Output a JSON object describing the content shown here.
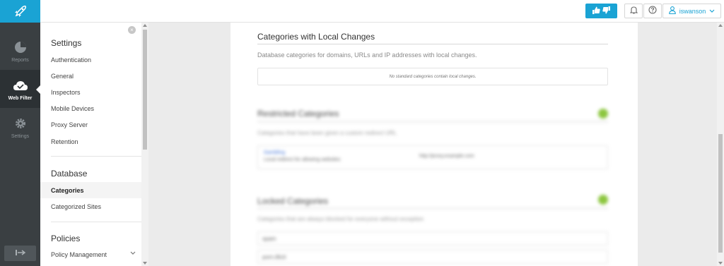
{
  "rail": {
    "items": [
      {
        "label": "Reports",
        "icon": "pie-chart-icon"
      },
      {
        "label": "Web Filter",
        "icon": "cloud-check-icon"
      },
      {
        "label": "Settings",
        "icon": "gear-icon"
      }
    ],
    "active": "Web Filter"
  },
  "topbar": {
    "username": "iswanson"
  },
  "sidenav": {
    "settings_heading": "Settings",
    "settings_items": [
      "Authentication",
      "General",
      "Inspectors",
      "Mobile Devices",
      "Proxy Server",
      "Retention"
    ],
    "database_heading": "Database",
    "database_items": [
      "Categories",
      "Categorized Sites"
    ],
    "policies_heading": "Policies",
    "policies_items": [
      "Policy Management"
    ],
    "active": "Categories"
  },
  "main": {
    "local_changes": {
      "title": "Categories with Local Changes",
      "description": "Database categories for domains, URLs and IP addresses with local changes.",
      "empty_message": "No standard categories contain local changes."
    },
    "restricted": {
      "title": "Restricted Categories",
      "description": "Categories that have been given a custom redirect URL",
      "item_name": "Gambling",
      "item_desc": "Local redirect for allowing websites",
      "item_url": "http://proxy.example.com"
    },
    "locked": {
      "title": "Locked Categories",
      "description": "Categories that are always blocked for everyone without exception",
      "rows": [
        "spam",
        "porn.illicit"
      ]
    }
  },
  "colors": {
    "accent": "#1aa3d4",
    "rail_bg": "#3a3f42",
    "badge": "#8cc63f"
  }
}
